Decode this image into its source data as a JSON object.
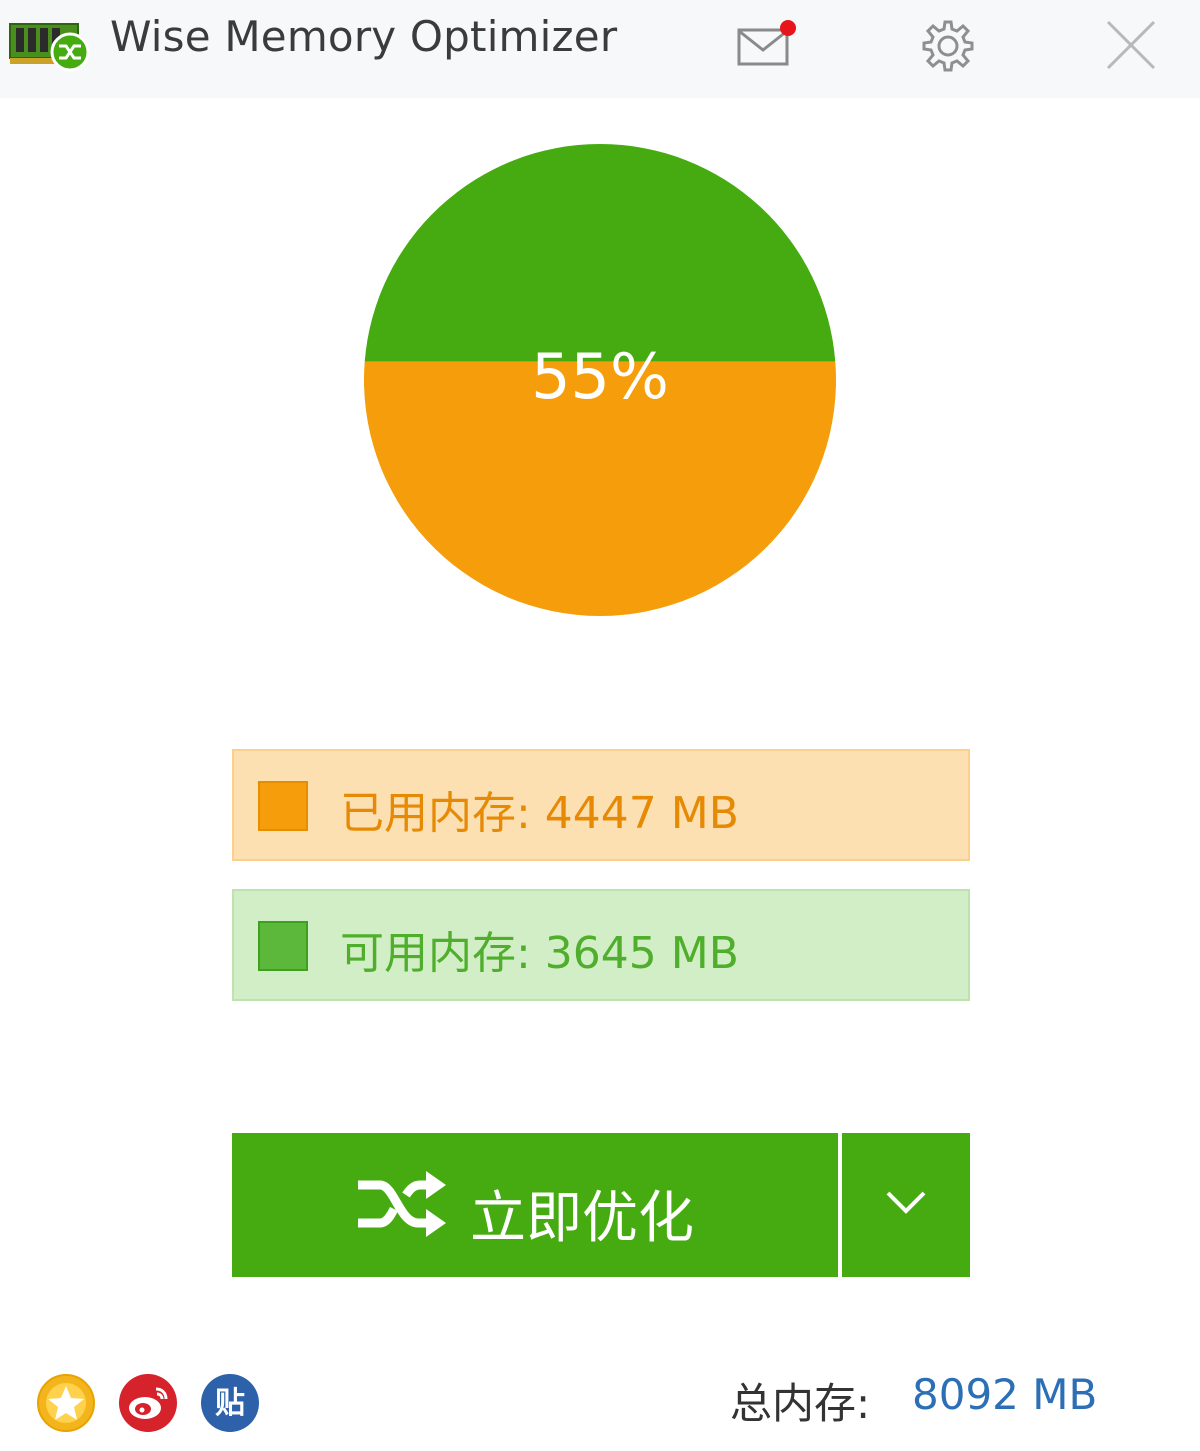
{
  "window": {
    "title": "Wise Memory Optimizer",
    "icons": {
      "logo": "memory-chip-icon",
      "mail": "mail-icon",
      "settings": "gear-icon",
      "close": "close-icon"
    },
    "has_unread_mail": true
  },
  "chart_data": {
    "type": "pie",
    "center_label": "55%",
    "slices": [
      {
        "name": "已用内存",
        "value": 4447,
        "color": "#f59d0a"
      },
      {
        "name": "可用内存",
        "value": 3645,
        "color": "#46ab10"
      }
    ]
  },
  "memory": {
    "used_label": "已用内存: 4447 MB",
    "free_label": "可用内存: 3645 MB",
    "used_color": "#f59d0a",
    "free_color": "#5bb83a"
  },
  "actions": {
    "optimize_label": "立即优化",
    "optimize_icon": "shuffle-icon",
    "dropdown_icon": "chevron-down-icon",
    "accent_color": "#46ab10"
  },
  "footer": {
    "social_icons": [
      "star-icon",
      "weibo-icon",
      "tieba-icon"
    ],
    "tieba_glyph": "贴",
    "total_label": "总内存:",
    "total_value": "8092 MB"
  }
}
